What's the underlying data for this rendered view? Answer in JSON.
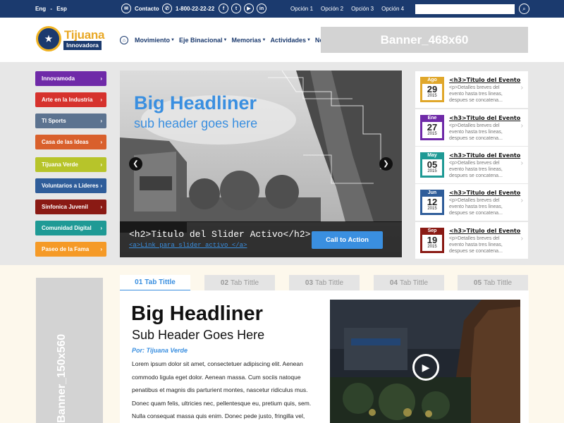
{
  "topbar": {
    "lang_en": "Eng",
    "lang_sep": "-",
    "lang_es": "Esp",
    "contact_label": "Contacto",
    "phone": "1-800-22-22-22",
    "options": [
      "Opción 1",
      "Opción 2",
      "Opción 3",
      "Opción 4"
    ]
  },
  "header": {
    "logo_line1": "Tijuana",
    "logo_line2": "Innovadora",
    "nav": [
      "Movimiento",
      "Eje Binacional",
      "Memorias",
      "Actividades",
      "Noticias"
    ],
    "banner_label": "Banner_468x60"
  },
  "sidebar": {
    "items": [
      {
        "label": "Innovamoda",
        "color": "#6f2aa8"
      },
      {
        "label": "Arte en la Industria",
        "color": "#d6322d"
      },
      {
        "label": "TI Sports",
        "color": "#5c7390"
      },
      {
        "label": "Casa de las Ideas",
        "color": "#d9602c"
      },
      {
        "label": "Tijuana Verde",
        "color": "#b7c42a"
      },
      {
        "label": "Voluntarios a Lideres",
        "color": "#2f5d9a"
      },
      {
        "label": "Sinfonica Juvenil",
        "color": "#8a1a14"
      },
      {
        "label": "Comunidad Digital",
        "color": "#1f9a95"
      },
      {
        "label": "Paseo de la Fama",
        "color": "#f59a27"
      }
    ]
  },
  "slider": {
    "headline": "Big Headliner",
    "subheader": "sub header goes here",
    "title": "<h2>Titulo del Slider Activo</h2>",
    "link": "<a>Link para slider activo </a>",
    "cta": "Call to Action"
  },
  "events": [
    {
      "month": "Ago",
      "day": "29",
      "year": "2015",
      "title": "<h3>Titulo del Evento",
      "text": "<p>Detalles breves del evento hasta tres lineas, despues se concatena...",
      "color": "#e0a72b"
    },
    {
      "month": "Ene",
      "day": "27",
      "year": "2015",
      "title": "<h3>Titulo del Evento",
      "text": "<p>Detalles breves del evento hasta tres lineas, despues se concatena...",
      "color": "#6f2aa8"
    },
    {
      "month": "May",
      "day": "05",
      "year": "2015",
      "title": "<h3>Titulo del Evento",
      "text": "<p>Detalles breves del evento hasta tres lineas, despues se concatena...",
      "color": "#1f9a95"
    },
    {
      "month": "Jun",
      "day": "12",
      "year": "2015",
      "title": "<h3>Titulo del Evento",
      "text": "<p>Detalles breves del evento hasta tres lineas, despues se concatena...",
      "color": "#2f5d9a"
    },
    {
      "month": "Sep",
      "day": "19",
      "year": "2015",
      "title": "<h3>Titulo del Evento",
      "text": "<p>Detalles breves del evento hasta tres lineas, despues se concatena...",
      "color": "#8a1a14"
    }
  ],
  "lower": {
    "vbanner_label": "Banner_150x560",
    "tabs": [
      {
        "num": "01",
        "label": "Tab Tittle"
      },
      {
        "num": "02",
        "label": "Tab Tittle"
      },
      {
        "num": "03",
        "label": "Tab Tittle"
      },
      {
        "num": "04",
        "label": "Tab Tittle"
      },
      {
        "num": "05",
        "label": "Tab Tittle"
      }
    ],
    "headline": "Big Headliner",
    "subheader": "Sub Header Goes Here",
    "author": "Por: Tijuana Verde",
    "body": "Lorem ipsum dolor sit amet, consectetuer adipiscing elit. Aenean commodo ligula eget dolor. Aenean massa. Cum sociis natoque penatibus et magnis dis parturient montes, nascetur ridiculus mus. Donec quam felis, ultricies nec, pellentesque eu, pretium quis, sem. Nulla consequat massa quis enim. Donec pede justo, fringilla vel,"
  }
}
